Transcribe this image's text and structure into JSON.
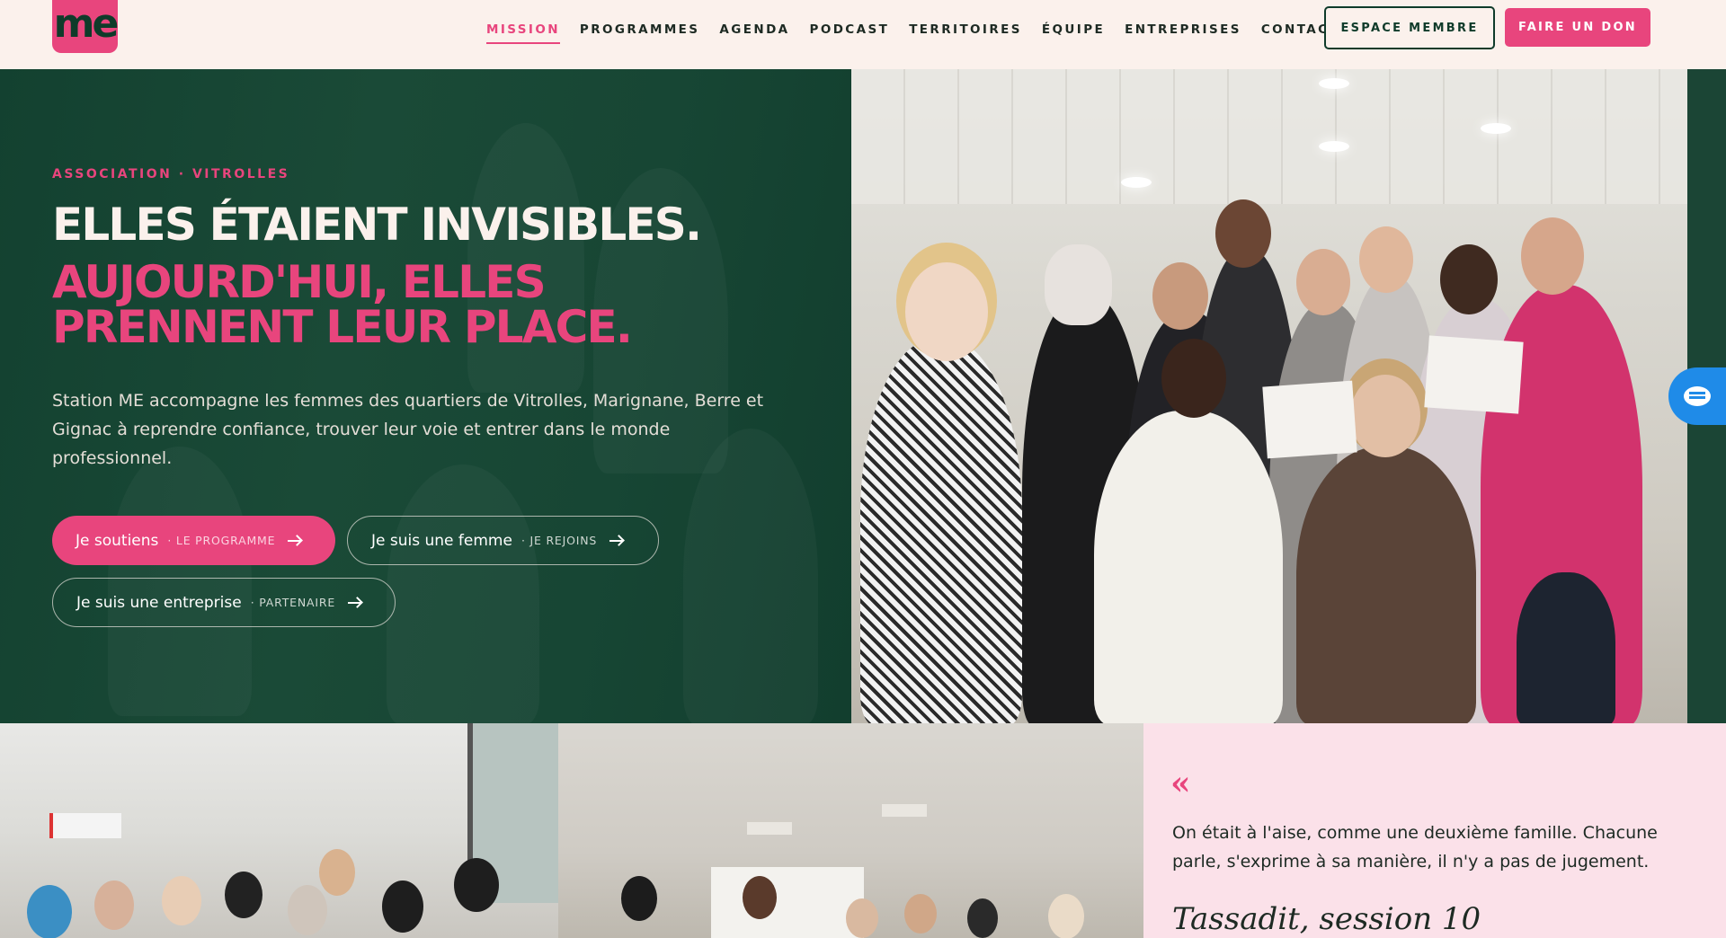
{
  "brand": {
    "logo_text": "me",
    "accent_color": "#e8457d",
    "dark_green": "#0f3b2a",
    "cream": "#fbf1ec"
  },
  "nav": {
    "items": [
      {
        "label": "MISSION",
        "active": true
      },
      {
        "label": "PROGRAMMES"
      },
      {
        "label": "AGENDA"
      },
      {
        "label": "PODCAST"
      },
      {
        "label": "TERRITOIRES"
      },
      {
        "label": "ÉQUIPE"
      },
      {
        "label": "ENTREPRISES"
      },
      {
        "label": "CONTACT"
      }
    ],
    "member_button": "ESPACE MEMBRE",
    "donate_button": "FAIRE UN DON"
  },
  "hero": {
    "eyebrow": "ASSOCIATION · VITROLLES",
    "title_line1": "ELLES ÉTAIENT INVISIBLES.",
    "title_line2": "AUJOURD'HUI, ELLES PRENNENT LEUR PLACE.",
    "lead": "Station ME accompagne les femmes des quartiers de Vitrolles, Marignane, Berre et Gignac à reprendre confiance, trouver leur voie et entrer dans le monde professionnel.",
    "ctas": [
      {
        "main": "Je soutiens",
        "sub": "· LE PROGRAMME"
      },
      {
        "main": "Je suis une femme",
        "sub": "· JE REJOINS"
      },
      {
        "main": "Je suis une entreprise",
        "sub": "· PARTENAIRE"
      }
    ]
  },
  "testimonial": {
    "quote_mark": "«",
    "text": "On était à l'aise, comme une deuxième famille. Chacune parle, s'exprime à sa manière, il n'y a pas de jugement.",
    "author": "Tassadit, session 10"
  },
  "icons": {
    "chat": "hand-wave-icon",
    "cta_arrow": "arrow-right-icon"
  }
}
